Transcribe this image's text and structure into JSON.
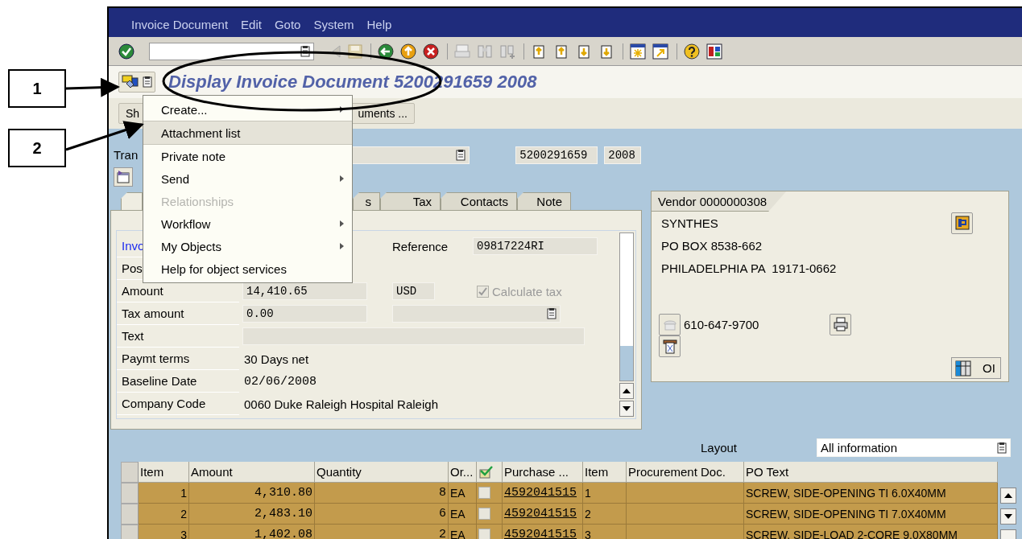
{
  "callouts": [
    {
      "label": "1"
    },
    {
      "label": "2"
    }
  ],
  "menu_bar": [
    {
      "label": "Invoice Document"
    },
    {
      "label": "Edit"
    },
    {
      "label": "Goto"
    },
    {
      "label": "System"
    },
    {
      "label": "Help"
    }
  ],
  "title": "Display Invoice Document 5200291659 2008",
  "app_toolbar": [
    {
      "label": "Sh"
    },
    {
      "label": "uments ..."
    }
  ],
  "header": {
    "label": "Tran",
    "document_number": "5200291659",
    "fiscal_year": "2008"
  },
  "tabs": [
    {
      "selected": true
    },
    {
      "label": "s",
      "selected": false
    },
    {
      "label": "Tax",
      "selected": false
    },
    {
      "label": "Contacts",
      "selected": false
    },
    {
      "label": "Note",
      "selected": false
    }
  ],
  "form_rows": [
    {
      "label": "Invo",
      "kind": "link",
      "reference_label": "Reference",
      "reference_value": "09817224RI"
    },
    {
      "label": "Pos",
      "kind": "plain"
    },
    {
      "label": "Amount",
      "kind": "input",
      "value": "14,410.65",
      "currency": "USD",
      "checkbox": {
        "label": "Calculate tax",
        "checked": true,
        "disabled": true
      }
    },
    {
      "label": "Tax amount",
      "kind": "input",
      "value": "0.00",
      "dropdown": true
    },
    {
      "label": "Text",
      "kind": "wide"
    },
    {
      "label": "Paymt terms",
      "kind": "text",
      "value": "30 Days net"
    },
    {
      "label": "Baseline Date",
      "kind": "text",
      "value": "02/06/2008"
    },
    {
      "label": "Company Code",
      "kind": "text",
      "value": "0060 Duke Raleigh Hospital Raleigh"
    }
  ],
  "vendor": {
    "title": "Vendor 0000000308",
    "lines": [
      "SYNTHES",
      "PO BOX 8538-662",
      "PHILADELPHIA PA  19171-0662"
    ],
    "phone": "610-647-9700",
    "oi_button": "OI"
  },
  "layout": {
    "label": "Layout",
    "value": "All information"
  },
  "table": {
    "columns": [
      {
        "label": "Item"
      },
      {
        "label": "Amount"
      },
      {
        "label": "Quantity"
      },
      {
        "label": "Or..."
      },
      {
        "kind": "icon"
      },
      {
        "label": "Purchase ..."
      },
      {
        "label": "Item"
      },
      {
        "label": "Procurement Doc."
      },
      {
        "label": "PO Text"
      }
    ],
    "rows": [
      {
        "item": "1",
        "amount": "4,310.80",
        "quantity": "8",
        "unit": "EA",
        "checked": false,
        "purchase_order": "4592041515",
        "po_item": "1",
        "po_text": "SCREW, SIDE-OPENING TI 6.0X40MM"
      },
      {
        "item": "2",
        "amount": "2,483.10",
        "quantity": "6",
        "unit": "EA",
        "checked": false,
        "purchase_order": "4592041515",
        "po_item": "2",
        "po_text": "SCREW, SIDE-OPENING TI 7.0X40MM"
      },
      {
        "item": "3",
        "amount": "1,402.08",
        "quantity": "2",
        "unit": "EA",
        "checked": false,
        "purchase_order": "4592041515",
        "po_item": "3",
        "po_text": "SCREW, SIDE-LOAD 2-CORE 9.0X80MM"
      }
    ]
  },
  "context_menu": [
    {
      "label": "Create...",
      "submenu": true,
      "disabled": false,
      "selected": false
    },
    {
      "label": "Attachment list",
      "submenu": false,
      "disabled": false,
      "selected": true
    },
    {
      "label": "Private note",
      "submenu": false,
      "disabled": false,
      "selected": false
    },
    {
      "label": "Send",
      "submenu": true,
      "disabled": false,
      "selected": false
    },
    {
      "label": "Relationships",
      "submenu": false,
      "disabled": true,
      "selected": false
    },
    {
      "label": "Workflow",
      "submenu": true,
      "disabled": false,
      "selected": false
    },
    {
      "label": "My Objects",
      "submenu": true,
      "disabled": false,
      "selected": false
    },
    {
      "label": "Help for object services",
      "submenu": false,
      "disabled": false,
      "selected": false
    }
  ]
}
